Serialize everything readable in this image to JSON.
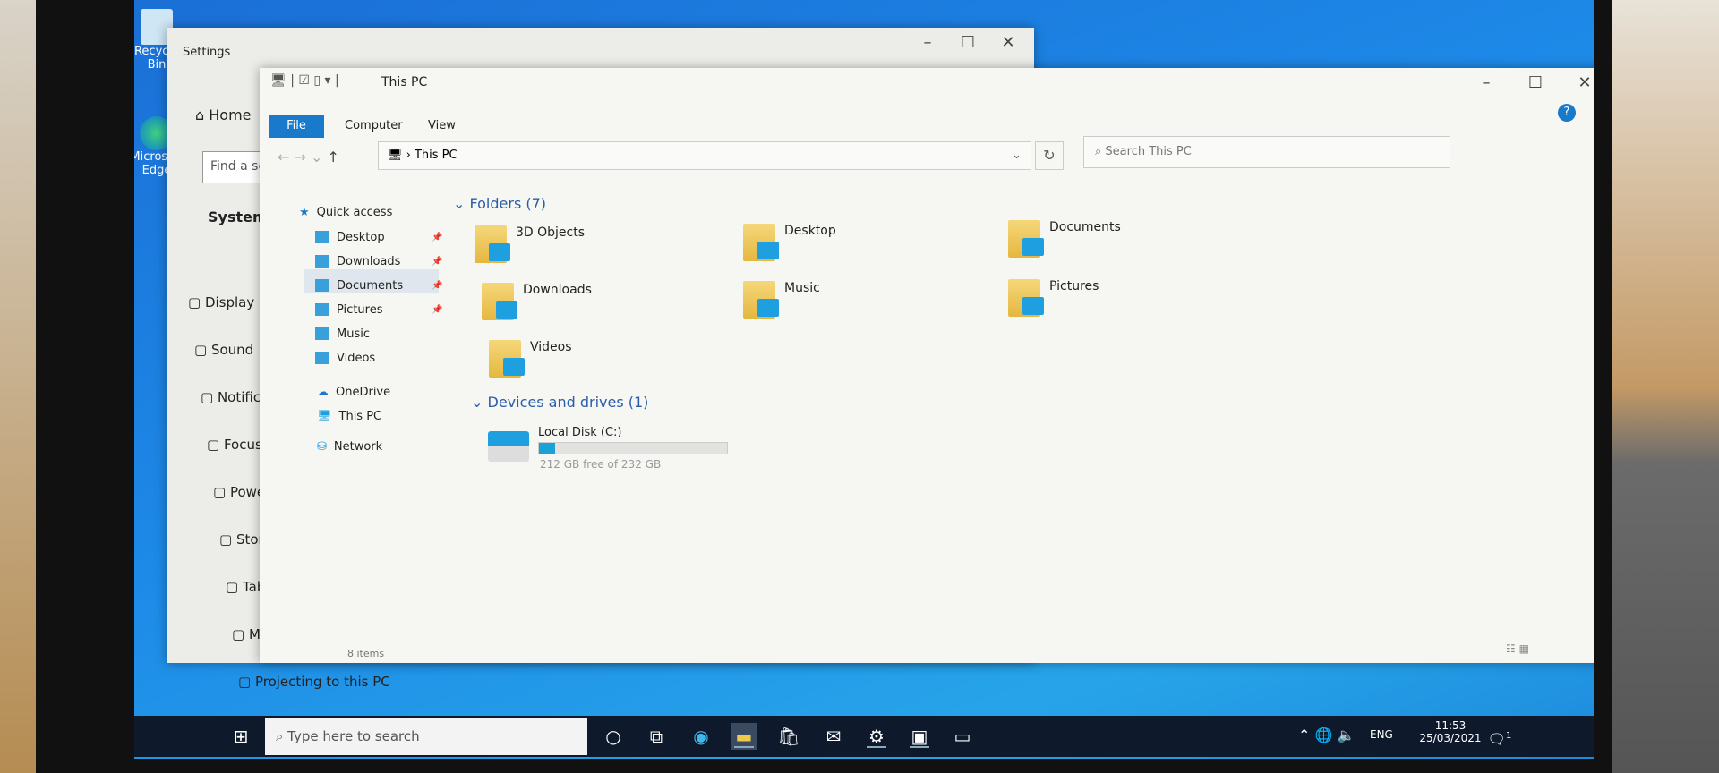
{
  "desktop": {
    "icons": [
      {
        "label": "Recycle Bin",
        "icon": "recycle-bin-icon"
      },
      {
        "label": "Microsoft Edge",
        "icon": "edge-icon"
      }
    ]
  },
  "settings": {
    "title": "Settings",
    "home": "Home",
    "search_placeholder": "Find a setting",
    "section": "System",
    "items": [
      "Display",
      "Sound",
      "Notifications & actions",
      "Focus assist",
      "Power & sleep",
      "Storage",
      "Tablet",
      "Multitasking",
      "Projecting to this PC"
    ]
  },
  "explorer": {
    "title": "This PC",
    "ribbon_tabs": [
      "File",
      "Computer",
      "View"
    ],
    "address": "This PC",
    "search_placeholder": "Search This PC",
    "nav": {
      "quick_access": "Quick access",
      "pinned": [
        "Desktop",
        "Downloads",
        "Documents",
        "Pictures"
      ],
      "other": [
        "Music",
        "Videos"
      ],
      "onedrive": "OneDrive",
      "this_pc": "This PC",
      "network": "Network"
    },
    "folders_header": "Folders (7)",
    "folders": [
      "3D Objects",
      "Desktop",
      "Documents",
      "Downloads",
      "Music",
      "Pictures",
      "Videos"
    ],
    "devices_header": "Devices and drives (1)",
    "drive": {
      "name": "Local Disk (C:)",
      "free_text": "212 GB free of 232 GB",
      "used_fraction": 0.086
    },
    "status": "8 items",
    "accent": "#1979ca"
  },
  "taskbar": {
    "search_placeholder": "Type here to search",
    "language": "ENG",
    "time": "11:53",
    "date": "25/03/2021",
    "notification_count": "1"
  }
}
